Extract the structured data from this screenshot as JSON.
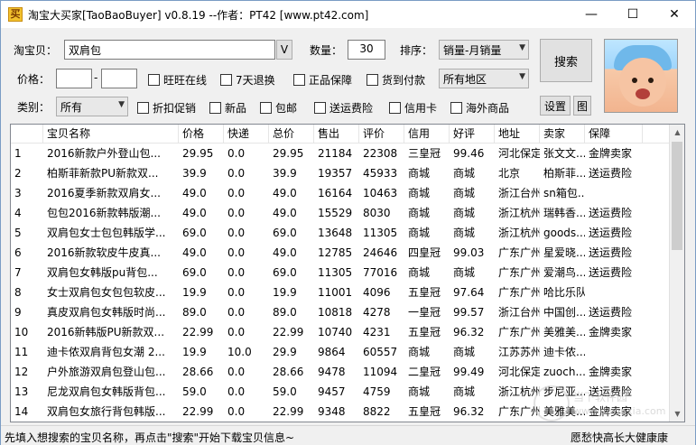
{
  "window": {
    "title": "淘宝大买家[TaoBaoBuyer] v0.8.19 --作者：PT42 [www.pt42.com]",
    "controls": {
      "minimize": "—",
      "maximize": "☐",
      "close": "✕"
    }
  },
  "search": {
    "keyword_label": "淘宝贝：",
    "keyword_value": "双肩包",
    "v_button": "V",
    "quantity_label": "数量：",
    "quantity_value": "30",
    "sort_label": "排序：",
    "sort_value": "销量-月销量",
    "search_button": "搜索"
  },
  "price": {
    "label": "价格：",
    "min_value": "",
    "dash": "-",
    "max_value": ""
  },
  "filters_row1": [
    {
      "label": "旺旺在线"
    },
    {
      "label": "7天退换"
    },
    {
      "label": "正品保障"
    },
    {
      "label": "货到付款"
    }
  ],
  "region_value": "所有地区",
  "category": {
    "label": "类别：",
    "value": "所有"
  },
  "filters_row2": [
    {
      "label": "折扣促销"
    },
    {
      "label": "新品"
    },
    {
      "label": "包邮"
    },
    {
      "label": "送运费险"
    },
    {
      "label": "信用卡"
    },
    {
      "label": "海外商品"
    }
  ],
  "settings_button": "设置",
  "image_button": "图",
  "table": {
    "columns": [
      "",
      "宝贝名称",
      "价格",
      "快递",
      "总价",
      "售出",
      "评价",
      "信用",
      "好评",
      "地址",
      "卖家",
      "保障"
    ],
    "rows": [
      [
        "1",
        "2016新款户外登山包...",
        "29.95",
        "0.0",
        "29.95",
        "21184",
        "22308",
        "三皇冠",
        "99.46",
        "河北保定",
        "张文文...",
        "金牌卖家"
      ],
      [
        "2",
        "柏斯菲新款PU新款双...",
        "39.9",
        "0.0",
        "39.9",
        "19357",
        "45933",
        "商城",
        "商城",
        "北京",
        "柏斯菲...",
        "送运费险"
      ],
      [
        "3",
        "2016夏季新款双肩女...",
        "49.0",
        "0.0",
        "49.0",
        "16164",
        "10463",
        "商城",
        "商城",
        "浙江台州",
        "sn箱包...",
        ""
      ],
      [
        "4",
        "包包2016新款韩版潮...",
        "49.0",
        "0.0",
        "49.0",
        "15529",
        "8030",
        "商城",
        "商城",
        "浙江杭州",
        "瑞韩香...",
        "送运费险"
      ],
      [
        "5",
        "双肩包女士包包韩版学...",
        "69.0",
        "0.0",
        "69.0",
        "13648",
        "11305",
        "商城",
        "商城",
        "浙江杭州",
        "goods...",
        "送运费险"
      ],
      [
        "6",
        "2016新款软皮牛皮真...",
        "49.0",
        "0.0",
        "49.0",
        "12785",
        "24646",
        "四皇冠",
        "99.03",
        "广东广州",
        "星爱晓...",
        "送运费险"
      ],
      [
        "7",
        "双肩包女韩版pu背包...",
        "69.0",
        "0.0",
        "69.0",
        "11305",
        "77016",
        "商城",
        "商城",
        "广东广州",
        "爱潮鸟...",
        "送运费险"
      ],
      [
        "8",
        "女士双肩包女包包软皮...",
        "19.9",
        "0.0",
        "19.9",
        "11001",
        "4096",
        "五皇冠",
        "97.64",
        "广东广州",
        "哈比乐队",
        ""
      ],
      [
        "9",
        "真皮双肩包女韩版时尚...",
        "89.0",
        "0.0",
        "89.0",
        "10818",
        "4278",
        "一皇冠",
        "99.57",
        "浙江台州",
        "中国创...",
        "送运费险"
      ],
      [
        "10",
        "2016新韩版PU新款双...",
        "22.99",
        "0.0",
        "22.99",
        "10740",
        "4231",
        "五皇冠",
        "96.32",
        "广东广州",
        "美雅美...",
        "金牌卖家"
      ],
      [
        "11",
        "迪卡侬双肩背包女潮 2...",
        "19.9",
        "10.0",
        "29.9",
        "9864",
        "60557",
        "商城",
        "商城",
        "江苏苏州",
        "迪卡侬...",
        ""
      ],
      [
        "12",
        "户外旅游双肩包登山包...",
        "28.66",
        "0.0",
        "28.66",
        "9478",
        "11094",
        "二皇冠",
        "99.49",
        "河北保定",
        "zuoch...",
        "金牌卖家"
      ],
      [
        "13",
        "尼龙双肩包女韩版背包...",
        "59.0",
        "0.0",
        "59.0",
        "9457",
        "4759",
        "商城",
        "商城",
        "浙江杭州",
        "步尼亚...",
        "送运费险"
      ],
      [
        "14",
        "双肩包女旅行背包韩版...",
        "22.99",
        "0.0",
        "22.99",
        "9348",
        "8822",
        "五皇冠",
        "96.32",
        "广东广州",
        "美雅美...",
        "金牌卖家"
      ]
    ]
  },
  "watermark": {
    "line1": "当下软件园",
    "line2": "www.downxia.com"
  },
  "status": {
    "left": "先填入想搜索的宝贝名称，再点击\"搜索\"开始下载宝贝信息~",
    "right": "愿愁快高长大健康康"
  }
}
